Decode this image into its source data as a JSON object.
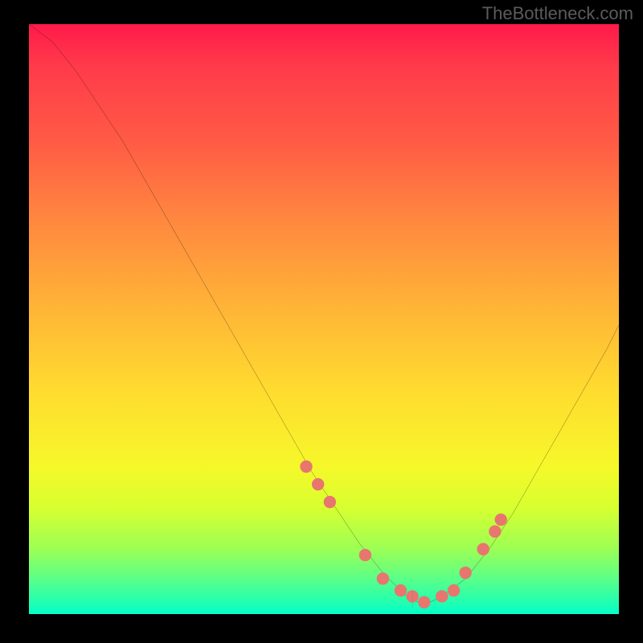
{
  "watermark": "TheBottleneck.com",
  "chart_data": {
    "type": "line",
    "title": "",
    "xlabel": "",
    "ylabel": "",
    "xlim": [
      0,
      100
    ],
    "ylim": [
      0,
      100
    ],
    "series": [
      {
        "name": "bottleneck-curve",
        "x": [
          0,
          4,
          8,
          12,
          16,
          20,
          24,
          28,
          32,
          36,
          40,
          44,
          48,
          52,
          56,
          60,
          62,
          64,
          66,
          68,
          70,
          74,
          78,
          82,
          86,
          90,
          94,
          98,
          100
        ],
        "y": [
          100,
          97,
          92,
          86,
          80,
          73,
          66,
          59,
          52,
          45,
          38,
          31,
          24,
          18,
          12,
          7,
          5,
          3,
          2,
          2,
          3,
          6,
          11,
          17,
          24,
          31,
          38,
          45,
          49
        ]
      }
    ],
    "markers": {
      "name": "highlighted-points",
      "x": [
        47,
        49,
        51,
        57,
        60,
        63,
        65,
        67,
        70,
        72,
        74,
        77,
        79,
        80
      ],
      "y": [
        25,
        22,
        19,
        10,
        6,
        4,
        3,
        2,
        3,
        4,
        7,
        11,
        14,
        16
      ]
    },
    "colors": {
      "curve": "#000000",
      "marker_fill": "#e8766f",
      "marker_stroke": "#e8766f"
    }
  }
}
